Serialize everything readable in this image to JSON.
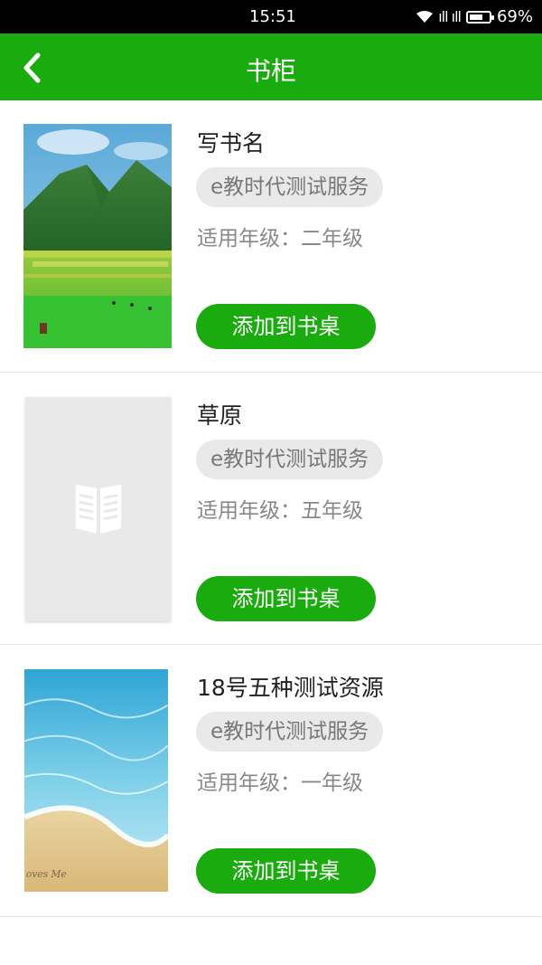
{
  "status_bar": {
    "time": "15:51",
    "signal": "ıll ıll",
    "battery_percent": "69%",
    "battery_level": 0.69
  },
  "header": {
    "title": "书柜",
    "back_icon": "chevron-left-icon"
  },
  "books": [
    {
      "title": "写书名",
      "publisher": "e教时代测试服务",
      "grade": "适用年级：二年级",
      "button": "添加到书桌",
      "cover": "mountain-landscape"
    },
    {
      "title": "草原",
      "publisher": "e教时代测试服务",
      "grade": "适用年级：五年级",
      "button": "添加到书桌",
      "cover": "placeholder-book-icon"
    },
    {
      "title": "18号五种测试资源",
      "publisher": "e教时代测试服务",
      "grade": "适用年级：一年级",
      "button": "添加到书桌",
      "cover": "beach-sea"
    }
  ],
  "colors": {
    "brand_green": "#1aac0e",
    "chip_bg": "#e9e9e9"
  }
}
